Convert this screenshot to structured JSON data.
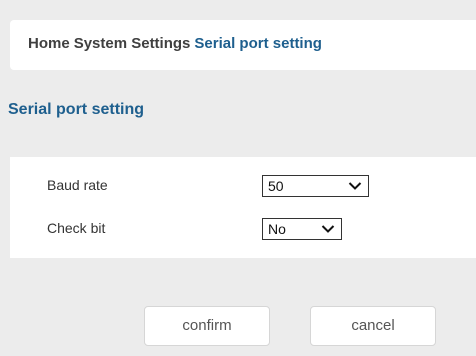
{
  "breadcrumb": {
    "home": "Home",
    "system_settings": "System Settings",
    "current": "Serial port setting"
  },
  "section": {
    "title": "Serial port setting"
  },
  "fields": {
    "baud_rate": {
      "label": "Baud rate",
      "value": "50"
    },
    "check_bit": {
      "label": "Check bit",
      "value": "No"
    }
  },
  "buttons": {
    "confirm": "confirm",
    "cancel": "cancel"
  },
  "colors": {
    "accent": "#1e5f8e",
    "background": "#ececec",
    "panel": "#ffffff"
  },
  "icons": {
    "select_arrow": "chevron-down-icon"
  }
}
